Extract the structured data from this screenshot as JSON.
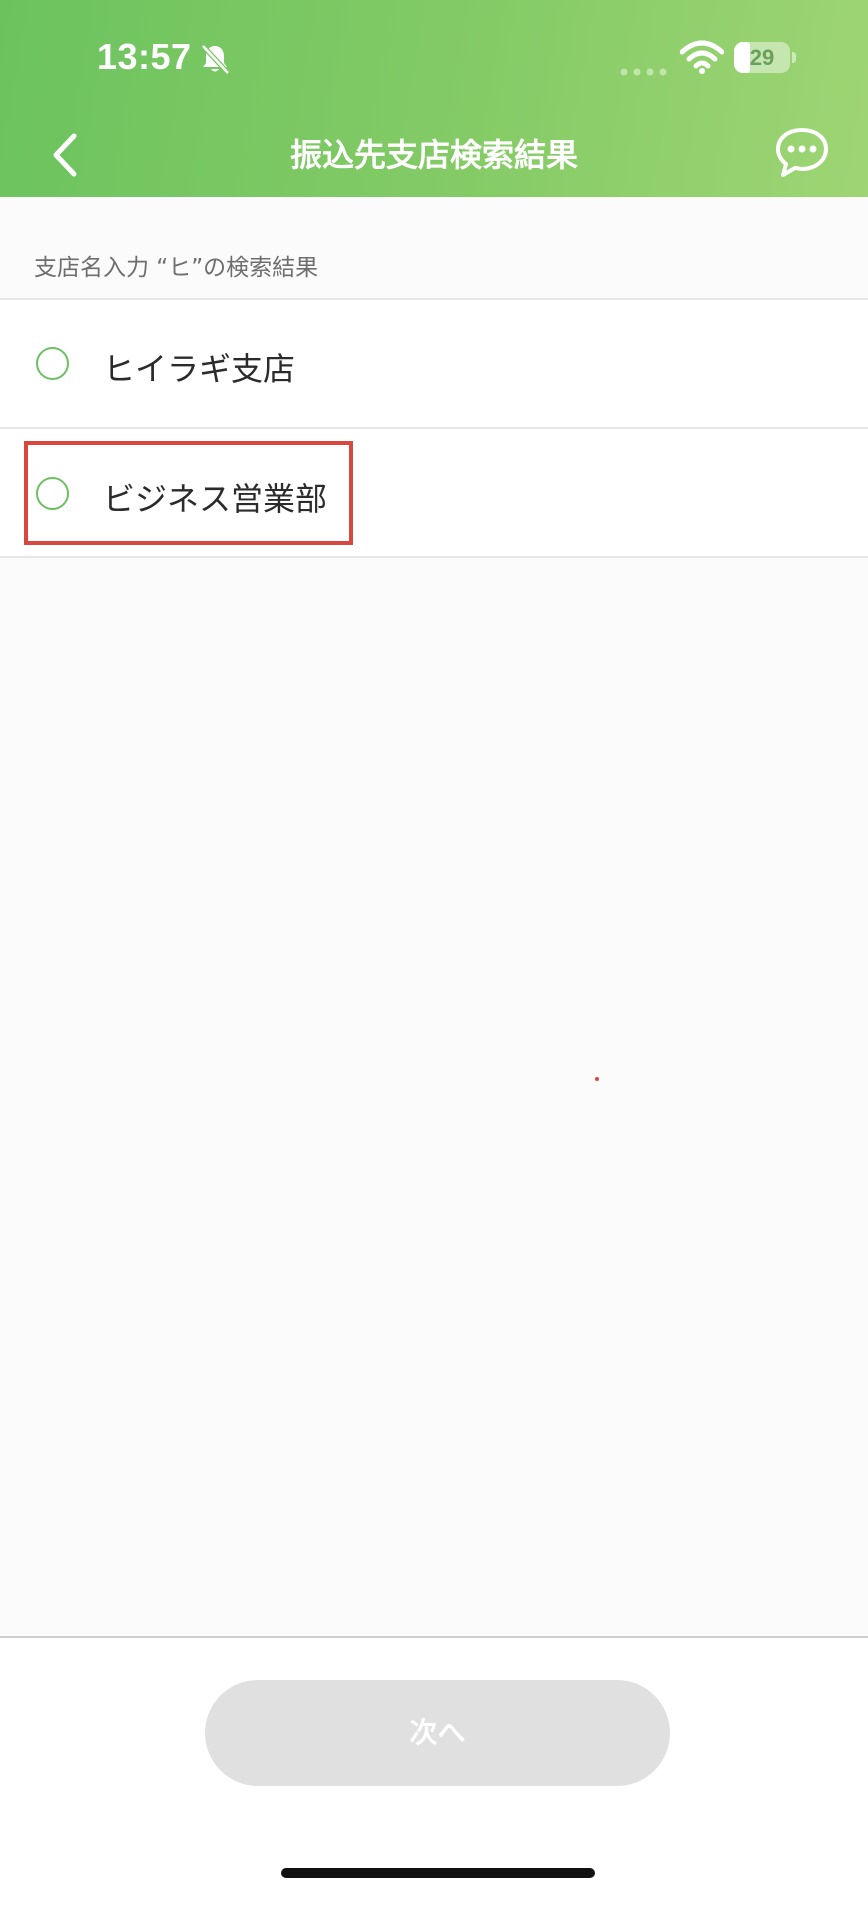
{
  "status_bar": {
    "time": "13:57",
    "battery_level": "29",
    "icons": [
      "bell-slash-icon",
      "signal-icon",
      "wifi-icon",
      "battery-icon"
    ]
  },
  "nav": {
    "title": "振込先支店検索結果",
    "back_icon": "chevron-left-icon",
    "chat_icon": "chat-bubble-icon"
  },
  "results": {
    "label": "支店名入力 “ヒ”の検索結果",
    "items": [
      {
        "label": "ヒイラギ支店",
        "selected": false
      },
      {
        "label": "ビジネス営業部",
        "selected": false
      }
    ]
  },
  "footer": {
    "next_label": "次へ",
    "next_enabled": false
  },
  "colors": {
    "header_start": "#6cc35e",
    "header_end": "#9fd574",
    "radio": "#6cc061",
    "highlight": "#d9483f",
    "button_disabled": "#e0e0e0"
  }
}
